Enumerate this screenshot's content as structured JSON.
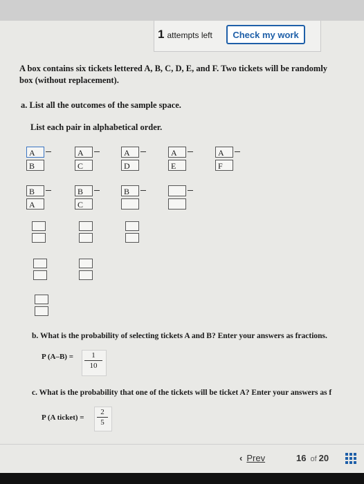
{
  "toolbar": {
    "attempts_count": "1",
    "attempts_label": "attempts left",
    "check_label": "Check my work"
  },
  "question": {
    "line1": "A box contains six tickets lettered A, B, C, D, E, and F. Two tickets will be randomly",
    "line2": "box (without replacement).",
    "part_a": "a. List all the outcomes of the sample space.",
    "instruction": "List each pair in alphabetical order."
  },
  "pairs": [
    [
      "A",
      "B"
    ],
    [
      "A",
      "C"
    ],
    [
      "A",
      "D"
    ],
    [
      "A",
      "E"
    ],
    [
      "A",
      "F"
    ],
    [
      "B",
      "A"
    ],
    [
      "B",
      "C"
    ],
    [
      "B",
      ""
    ],
    [
      "",
      ""
    ],
    [
      "",
      ""
    ],
    [
      "",
      ""
    ],
    [
      "",
      ""
    ],
    [
      "",
      ""
    ],
    [
      "",
      ""
    ],
    [
      "",
      ""
    ]
  ],
  "part_b": {
    "text": "b. What is the probability of selecting tickets A and B? Enter your answers as fractions.",
    "label": "P (A–B) =",
    "numerator": "1",
    "denominator": "10"
  },
  "part_c": {
    "text": "c. What is the probability that one of the tickets will be ticket A? Enter your answers as f",
    "label": "P (A ticket) =",
    "numerator": "2",
    "denominator": "5"
  },
  "footer": {
    "prev_label": "Prev",
    "current_page": "16",
    "of_label": "of",
    "total_pages": "20"
  },
  "colors": {
    "accent": "#1e5fa8",
    "input_border_focus": "#3a74c2"
  }
}
